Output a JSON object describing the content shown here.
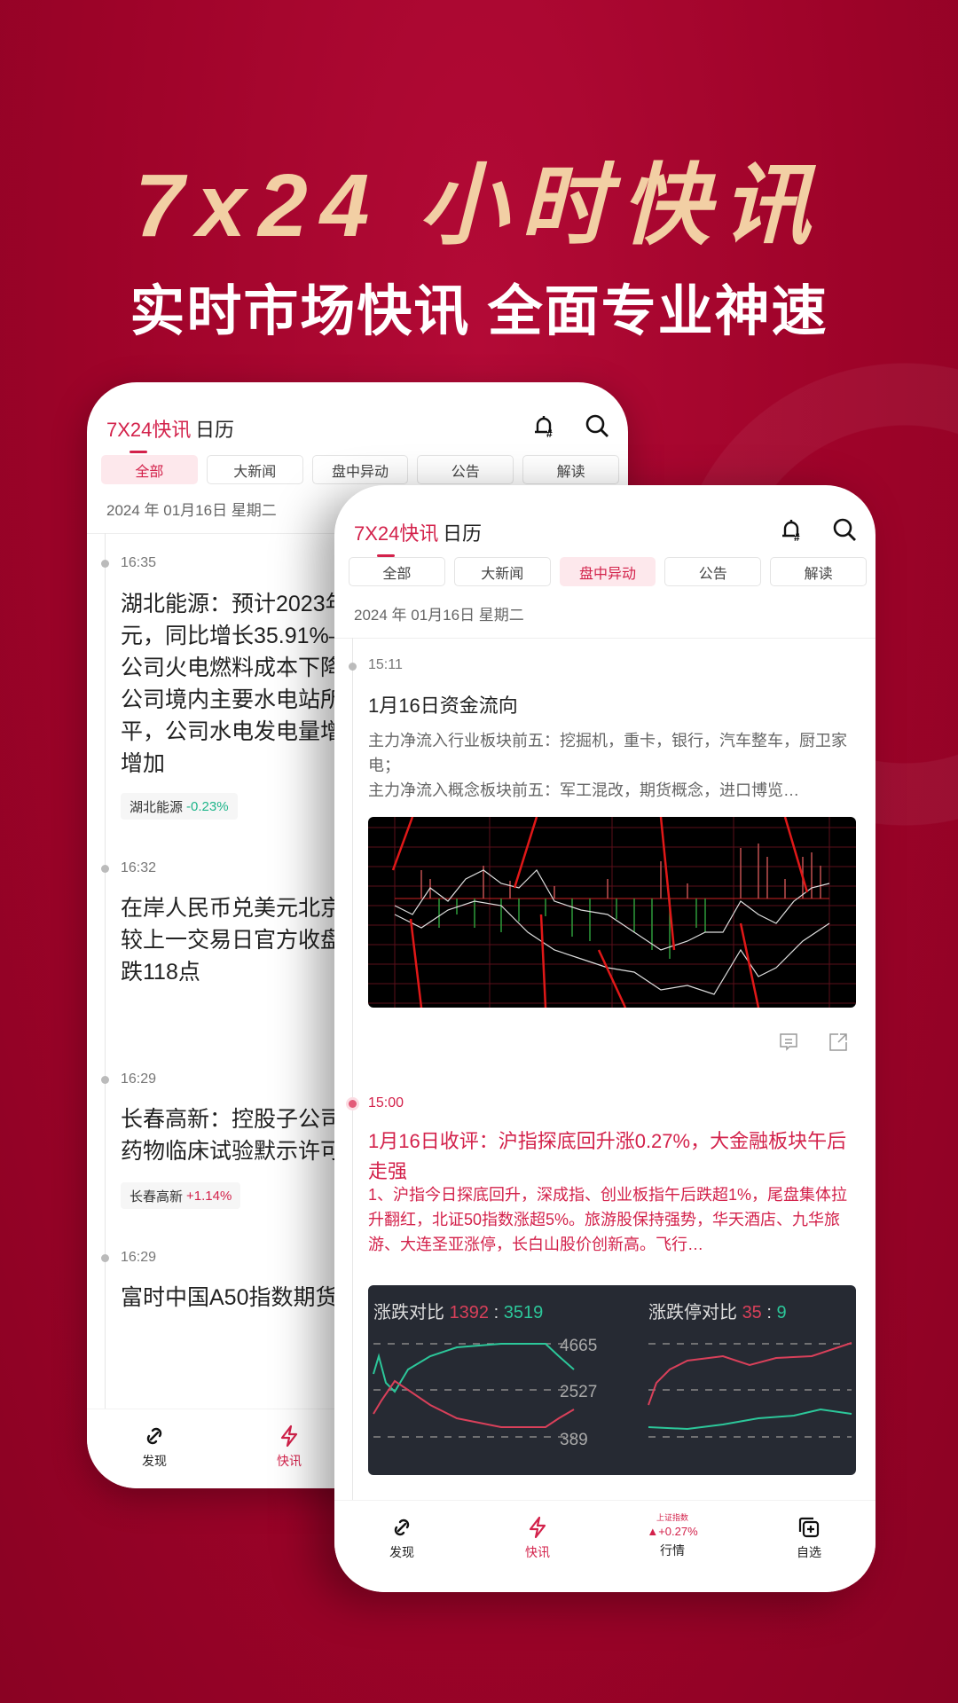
{
  "hero": {
    "title": "7x24 小时快讯",
    "subtitle": "实时市场快讯  全面专业神速"
  },
  "colors": {
    "brand": "#d3224b",
    "background": "#a5062c",
    "title_gold": "#f2cfa4",
    "up": "#d3224b",
    "down": "#1fb58a"
  },
  "back_phone": {
    "tabs": [
      "7X24快讯",
      "日历"
    ],
    "filters": [
      "全部",
      "大新闻",
      "盘中异动",
      "公告",
      "解读"
    ],
    "active_filter": "全部",
    "date": "2024 年 01月16日  星期二",
    "items": [
      {
        "time": "16:35",
        "lines": [
          "湖北能源：预计2023年",
          "元，同比增长35.91%–",
          "公司火电燃料成本下降",
          "公司境内主要水电站所",
          "平，公司水电发电量增",
          "增加"
        ],
        "tag": {
          "name": "湖北能源",
          "change": "-0.23%"
        }
      },
      {
        "time": "16:32",
        "lines": [
          "在岸人民币兑美元北京",
          "较上一交易日官方收盘",
          "跌118点"
        ]
      },
      {
        "time": "16:29",
        "lines": [
          "长春高新：控股子公司",
          "药物临床试验默示许可"
        ],
        "tag": {
          "name": "长春高新",
          "change": "+1.14%"
        }
      },
      {
        "time": "16:29",
        "lines": [
          "富时中国A50指数期货"
        ]
      }
    ],
    "nav": [
      "发现",
      "快讯"
    ]
  },
  "front_phone": {
    "tabs": [
      "7X24快讯",
      "日历"
    ],
    "filters": [
      "全部",
      "大新闻",
      "盘中异动",
      "公告",
      "解读"
    ],
    "active_filter": "盘中异动",
    "date": "2024 年 01月16日  星期二",
    "items": [
      {
        "time": "15:11",
        "title": "1月16日资金流向",
        "body": "主力净流入行业板块前五：挖掘机，重卡，银行，汽车整车，厨卫家电；\n主力净流入概念板块前五：军工混改，期货概念，进口博览…"
      },
      {
        "time": "15:00",
        "title": "1月16日收评：沪指探底回升涨0.27%，大金融板块午后走强",
        "body": "1、沪指今日探底回升，深成指、创业板指午后跌超1%，尾盘集体拉升翻红，北证50指数涨超5%。旅游股保持强势，华天酒店、九华旅游、大连圣亚涨停，长白山股价创新高。飞行…",
        "image": {
          "left_title": "涨跌对比",
          "up": "1392",
          "sep": ":",
          "down": "3519",
          "levels": [
            "4665",
            "2527",
            "389"
          ],
          "right_title": "涨跌停对比",
          "limit_up": "35",
          "limit_down": "9"
        }
      }
    ],
    "nav": [
      {
        "label": "发现"
      },
      {
        "label": "快讯"
      },
      {
        "label": "行情",
        "index_name": "上证指数",
        "index_change": "▲+0.27%"
      },
      {
        "label": "自选"
      }
    ]
  }
}
